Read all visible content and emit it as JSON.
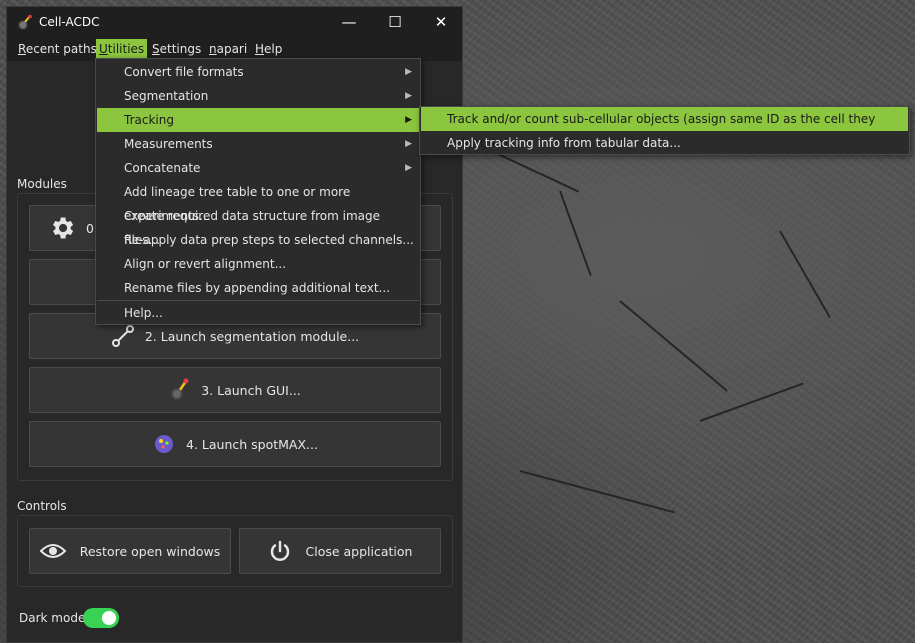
{
  "window": {
    "title": "Cell-ACDC",
    "minimize_glyph": "—",
    "maximize_glyph": "☐",
    "close_glyph": "✕"
  },
  "menubar": {
    "items": [
      {
        "label": "Recent paths",
        "underline": "R",
        "rest": "ecent paths"
      },
      {
        "label": "Utilities",
        "underline": "U",
        "rest": "tilities"
      },
      {
        "label": "Settings",
        "underline": "S",
        "rest": "ettings"
      },
      {
        "label": "napari",
        "underline": "n",
        "rest": "apari"
      },
      {
        "label": "Help",
        "underline": "H",
        "rest": "elp"
      }
    ]
  },
  "utilities_menu": {
    "items": [
      "Convert file formats",
      "Segmentation",
      "Tracking",
      "Measurements",
      "Concatenate",
      "Add lineage tree table to one or more experiments...",
      "Create required data structure from image files...",
      "Re-apply data prep steps to selected channels...",
      "Align or revert alignment...",
      "Rename files by appending additional text...",
      "Help..."
    ],
    "arrow_glyph": "▶"
  },
  "tracking_submenu": {
    "items": [
      "Track and/or count sub-cellular objects (assign same ID as the cell they belong to)...",
      "Apply tracking info from tabular data..."
    ]
  },
  "modules": {
    "label": "Modules",
    "buttons": [
      {
        "label": "0.",
        "icon": "gear-icon"
      },
      {
        "label": "",
        "icon": ""
      },
      {
        "label": "2. Launch segmentation module...",
        "icon": "segmentation-icon"
      },
      {
        "label": "3. Launch GUI...",
        "icon": "gui-icon"
      },
      {
        "label": "4. Launch spotMAX...",
        "icon": "spotmax-icon"
      }
    ]
  },
  "controls": {
    "label": "Controls",
    "restore_label": "Restore open windows",
    "close_label": "Close application"
  },
  "dark_mode": {
    "label": "Dark mode",
    "enabled": true
  },
  "colors": {
    "accent": "#8cc63f",
    "toggle_on": "#39d353"
  }
}
